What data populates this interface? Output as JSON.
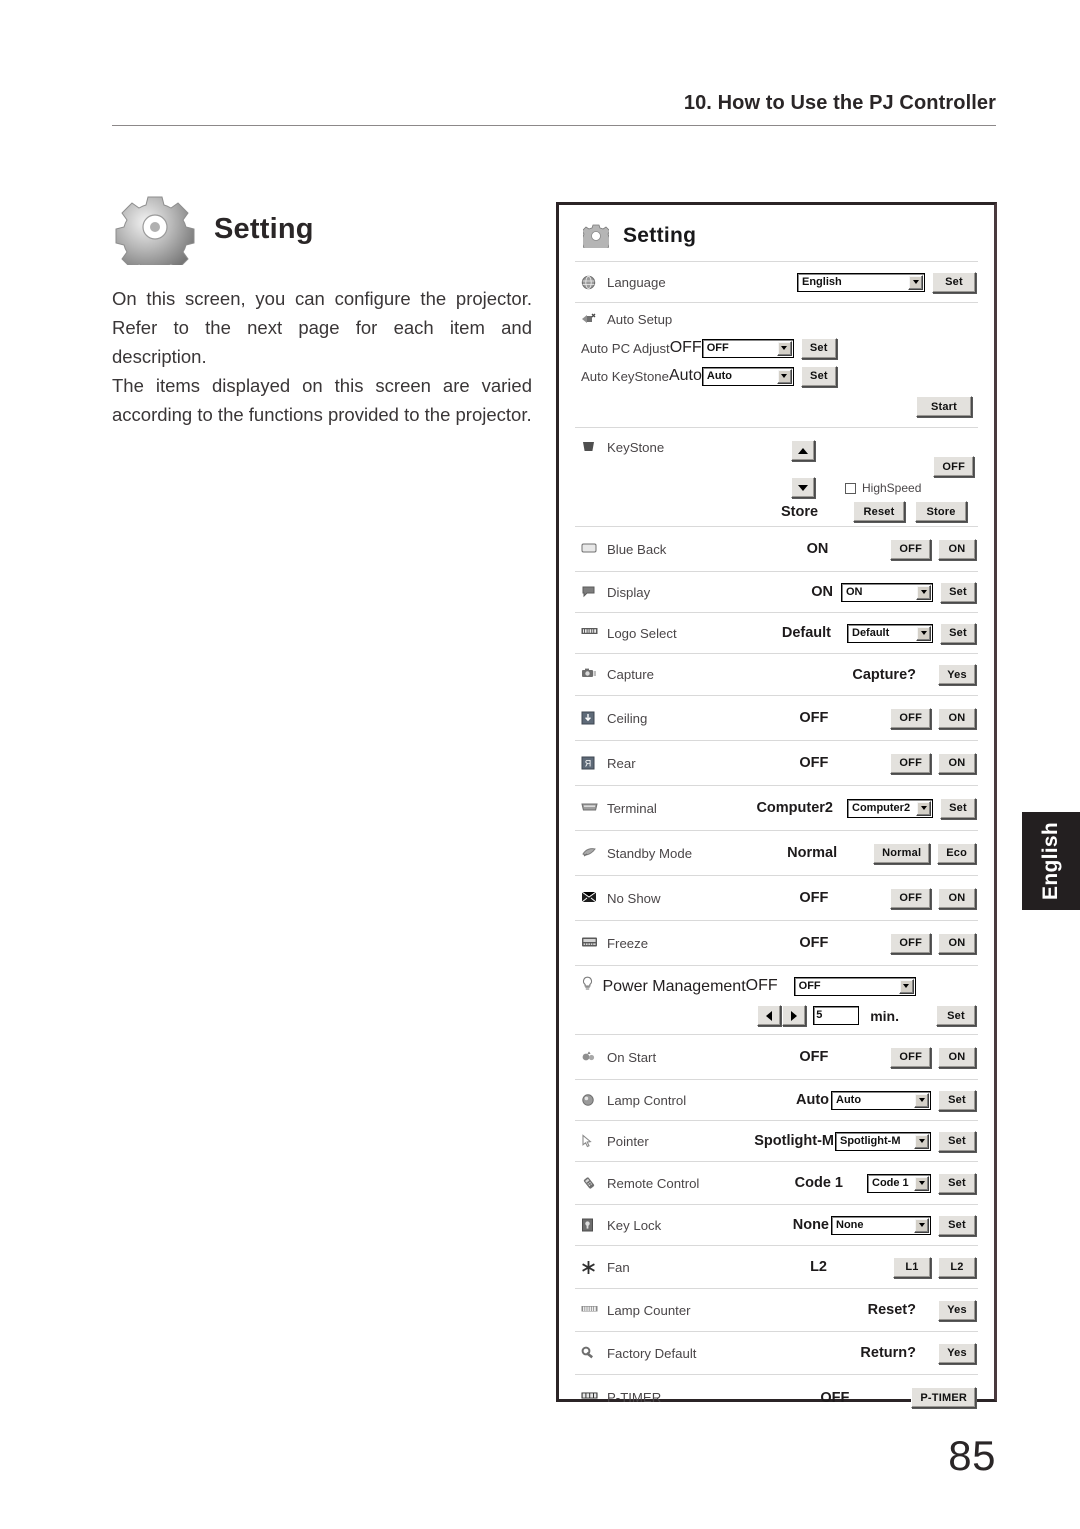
{
  "page": {
    "running_head": "10. How to Use the PJ Controller",
    "number": "85",
    "side_tab": "English"
  },
  "left": {
    "heading": "Setting",
    "heading_icon": "gear-icon",
    "paragraphs": [
      "On this screen, you can configure the projector. Refer to the next page for each item and description.",
      "The items displayed on this screen are varied according to the functions provided to the projector."
    ]
  },
  "dialog": {
    "title": "Setting",
    "title_icon": "gear-icon",
    "rows": {
      "language": {
        "label": "Language",
        "icon": "globe-icon",
        "select_value": "English",
        "set_label": "Set"
      },
      "auto_setup": {
        "label": "Auto Setup",
        "icon": "auto-setup-icon",
        "auto_pc_adjust": {
          "label": "Auto PC Adjust",
          "value": "OFF",
          "select_value": "OFF",
          "set_label": "Set"
        },
        "auto_keystone": {
          "label": "Auto KeyStone",
          "value": "Auto",
          "select_value": "Auto",
          "set_label": "Set"
        },
        "start_label": "Start"
      },
      "keystone": {
        "label": "KeyStone",
        "icon": "keystone-icon",
        "up_icon": "arrow-up-icon",
        "down_icon": "arrow-down-icon",
        "off_label": "OFF",
        "highspeed_label": "HighSpeed",
        "highspeed_checked": false,
        "store_value": "Store",
        "reset_label": "Reset",
        "store_label": "Store"
      },
      "blue_back": {
        "label": "Blue Back",
        "icon": "screen-icon",
        "value": "ON",
        "off_label": "OFF",
        "on_label": "ON"
      },
      "display": {
        "label": "Display",
        "icon": "display-icon",
        "value": "ON",
        "select_value": "ON",
        "set_label": "Set"
      },
      "logo_select": {
        "label": "Logo Select",
        "icon": "logo-icon",
        "value": "Default",
        "select_value": "Default",
        "set_label": "Set"
      },
      "capture": {
        "label": "Capture",
        "icon": "camera-icon",
        "value": "Capture?",
        "yes_label": "Yes"
      },
      "ceiling": {
        "label": "Ceiling",
        "icon": "ceiling-icon",
        "value": "OFF",
        "off_label": "OFF",
        "on_label": "ON"
      },
      "rear": {
        "label": "Rear",
        "icon": "rear-icon",
        "value": "OFF",
        "off_label": "OFF",
        "on_label": "ON"
      },
      "terminal": {
        "label": "Terminal",
        "icon": "terminal-icon",
        "value": "Computer2",
        "select_value": "Computer2",
        "set_label": "Set"
      },
      "standby_mode": {
        "label": "Standby Mode",
        "icon": "standby-icon",
        "value": "Normal",
        "normal_label": "Normal",
        "eco_label": "Eco"
      },
      "no_show": {
        "label": "No Show",
        "icon": "no-show-icon",
        "value": "OFF",
        "off_label": "OFF",
        "on_label": "ON"
      },
      "freeze": {
        "label": "Freeze",
        "icon": "freeze-icon",
        "value": "OFF",
        "off_label": "OFF",
        "on_label": "ON"
      },
      "power_management": {
        "label": "Power Management",
        "icon": "bulb-icon",
        "value": "OFF",
        "select_value": "OFF",
        "left_icon": "arrow-left-icon",
        "right_icon": "arrow-right-icon",
        "minutes": "5",
        "unit_label": "min.",
        "set_label": "Set"
      },
      "on_start": {
        "label": "On Start",
        "icon": "on-start-icon",
        "value": "OFF",
        "off_label": "OFF",
        "on_label": "ON"
      },
      "lamp_control": {
        "label": "Lamp Control",
        "icon": "lamp-icon",
        "value": "Auto",
        "select_value": "Auto",
        "set_label": "Set"
      },
      "pointer": {
        "label": "Pointer",
        "icon": "pointer-icon",
        "value": "Spotlight-M",
        "select_value": "Spotlight-M",
        "set_label": "Set"
      },
      "remote_control": {
        "label": "Remote Control",
        "icon": "remote-icon",
        "value": "Code 1",
        "select_value": "Code 1",
        "set_label": "Set"
      },
      "key_lock": {
        "label": "Key Lock",
        "icon": "lock-icon",
        "value": "None",
        "select_value": "None",
        "set_label": "Set"
      },
      "fan": {
        "label": "Fan",
        "icon": "fan-icon",
        "value": "L2",
        "l1_label": "L1",
        "l2_label": "L2"
      },
      "lamp_counter": {
        "label": "Lamp Counter",
        "icon": "counter-icon",
        "value": "Reset?",
        "yes_label": "Yes"
      },
      "factory_default": {
        "label": "Factory Default",
        "icon": "factory-icon",
        "value": "Return?",
        "yes_label": "Yes"
      },
      "p_timer": {
        "label": "P-TIMER",
        "icon": "ptimer-icon",
        "value": "OFF",
        "button_label": "P-TIMER"
      }
    }
  }
}
